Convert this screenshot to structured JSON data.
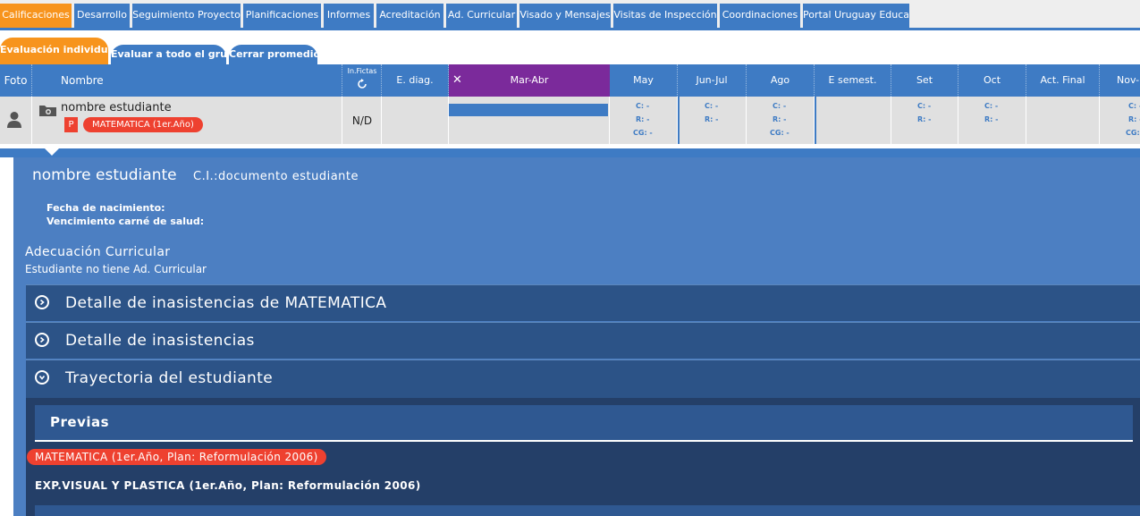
{
  "nav": {
    "tabs": [
      "Calificaciones",
      "Desarrollo",
      "Seguimiento Proyecto",
      "Planificaciones",
      "Informes",
      "Acreditación",
      "Ad. Curricular",
      "Visado y Mensajes",
      "Visitas de Inspección",
      "Coordinaciones",
      "Portal Uruguay Educa"
    ],
    "active_index": 0
  },
  "subtabs": [
    "Evaluación individual",
    "Evaluar a todo el grupo",
    "Cerrar promedios"
  ],
  "grid": {
    "headers": {
      "foto": "Foto",
      "nombre": "Nombre",
      "inasistencias": "In.Fictas",
      "ediag": "E. diag.",
      "close": "✕",
      "marabr": "Mar-Abr",
      "may": "May",
      "junjul": "Jun-Jul",
      "ago": "Ago",
      "esemest": "E semest.",
      "set": "Set",
      "oct": "Oct",
      "actfinal": "Act. Final",
      "novdic": "Nov-Dic"
    },
    "row": {
      "name": "nombre estudiante",
      "badge_p": "P",
      "subject": "MATEMATICA (1er.Año)",
      "inasist": "N/D",
      "may": {
        "c": "C: -",
        "r": "R: -",
        "cg": "CG: -"
      },
      "junjul": {
        "c": "C: -",
        "r": "R: -"
      },
      "ago": {
        "c": "C: -",
        "r": "R: -",
        "cg": "CG: -"
      },
      "set": {
        "c": "C: -",
        "r": "R: -"
      },
      "oct": {
        "c": "C: -",
        "r": "R: -"
      },
      "novdic": {
        "c": "C: -",
        "r": "R: -",
        "cg": "CG: -"
      }
    }
  },
  "student": {
    "name": "nombre estudiante",
    "ci": "C.I.:documento estudiante",
    "birth_label": "Fecha de nacimiento:",
    "health_label": "Vencimiento carné de salud:",
    "adec_title": "Adecuación Curricular",
    "adec_text": "Estudiante no tiene Ad. Curricular"
  },
  "accordion": [
    {
      "label": "Detalle de inasistencias de MATEMATICA",
      "expanded": false
    },
    {
      "label": "Detalle de inasistencias",
      "expanded": false
    },
    {
      "label": "Trayectoria del estudiante",
      "expanded": true
    }
  ],
  "previas": {
    "title": "Previas",
    "items": [
      {
        "label": "MATEMATICA (1er.Año, Plan: Reformulación 2006)",
        "highlight": true
      },
      {
        "label": "EXP.VISUAL Y PLASTICA (1er.Año, Plan: Reformulación 2006)",
        "highlight": false
      }
    ]
  },
  "colors": {
    "blue": "#3e7bc4",
    "orange": "#f7941d",
    "purple": "#7b2a9b",
    "red": "#ee4130",
    "navy": "#2c5387"
  }
}
